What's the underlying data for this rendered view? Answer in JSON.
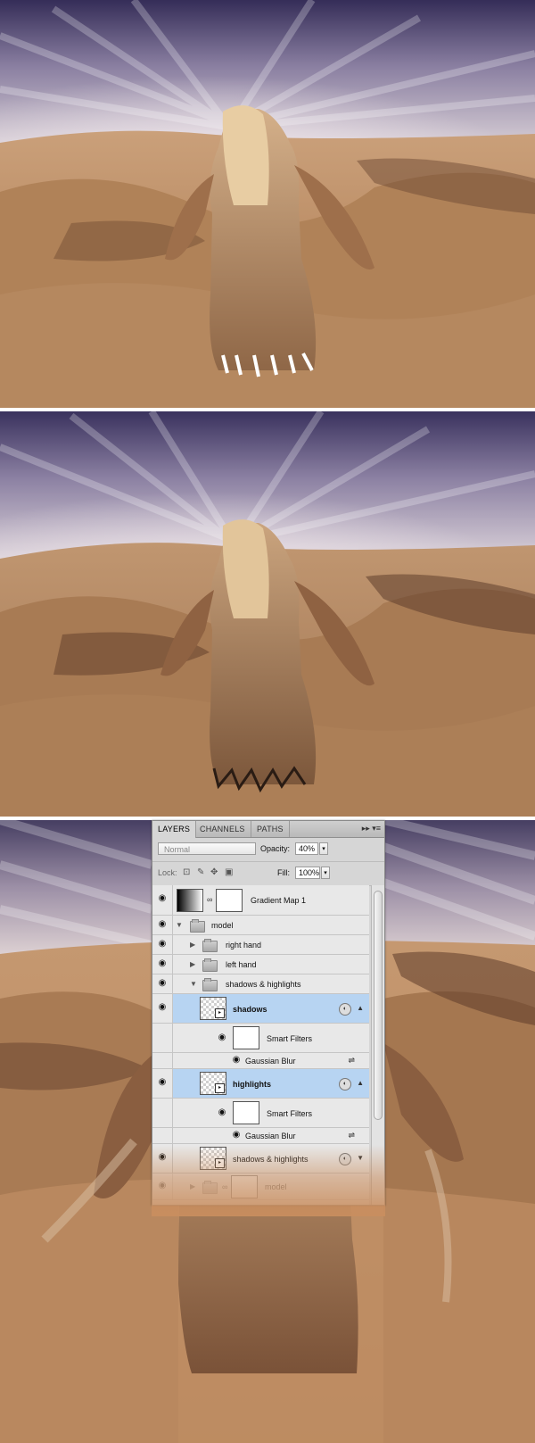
{
  "panel": {
    "tabs": [
      "LAYERS",
      "CHANNELS",
      "PATHS"
    ],
    "tab_controls": "▸▸ ▾≡",
    "blend_mode": "Normal",
    "opacity_label": "Opacity:",
    "opacity_value": "40%",
    "lock_label": "Lock:",
    "fill_label": "Fill:",
    "fill_value": "100%",
    "layers": [
      {
        "name": "Gradient Map 1"
      },
      {
        "name": "model"
      },
      {
        "name": "right hand"
      },
      {
        "name": "left hand"
      },
      {
        "name": "shadows & highlights"
      },
      {
        "name": "shadows"
      },
      {
        "name": "Smart Filters"
      },
      {
        "name": "Gaussian Blur"
      },
      {
        "name": "highlights"
      },
      {
        "name": "Smart Filters"
      },
      {
        "name": "Gaussian Blur"
      },
      {
        "name": "shadows & highlights"
      },
      {
        "name": "model"
      }
    ]
  },
  "colors": {
    "sky_top": "#3d3560",
    "sky_glow": "#f4eef0",
    "sand_light": "#c89468",
    "sand_dark": "#6f4a33",
    "selected_layer": "#b7d4f2"
  },
  "icons": [
    "eye-icon",
    "folder-icon",
    "chain-link-icon",
    "smart-object-icon",
    "filter-options-icon",
    "expand-triangle-icon",
    "collapse-triangle-icon",
    "panel-menu-icon"
  ]
}
